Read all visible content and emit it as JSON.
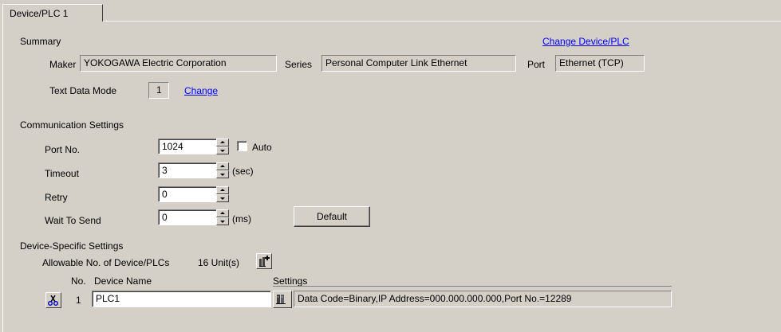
{
  "tab": {
    "label": "Device/PLC 1"
  },
  "summary": {
    "heading": "Summary",
    "change_device_link": "Change Device/PLC",
    "maker_label": "Maker",
    "maker_value": "YOKOGAWA Electric Corporation",
    "series_label": "Series",
    "series_value": "Personal Computer Link Ethernet",
    "port_label": "Port",
    "port_value": "Ethernet (TCP)",
    "text_data_mode_label": "Text Data Mode",
    "text_data_mode_value": "1",
    "change_link": "Change"
  },
  "comm": {
    "heading": "Communication Settings",
    "port_no_label": "Port No.",
    "port_no_value": "1024",
    "auto_label": "Auto",
    "auto_checked": false,
    "timeout_label": "Timeout",
    "timeout_value": "3",
    "timeout_unit": "(sec)",
    "retry_label": "Retry",
    "retry_value": "0",
    "wait_label": "Wait To Send",
    "wait_value": "0",
    "wait_unit": "(ms)",
    "default_button": "Default"
  },
  "device": {
    "heading": "Device-Specific Settings",
    "allowable_label": "Allowable No. of Device/PLCs",
    "allowable_value": "16 Unit(s)",
    "col_no": "No.",
    "col_name": "Device Name",
    "col_settings": "Settings",
    "rows": [
      {
        "no": "1",
        "name": "PLC1",
        "settings": "Data Code=Binary,IP Address=000.000.000.000,Port No.=12289"
      }
    ]
  },
  "colors": {
    "background": "#d4d0c8",
    "link": "#0000ff"
  }
}
